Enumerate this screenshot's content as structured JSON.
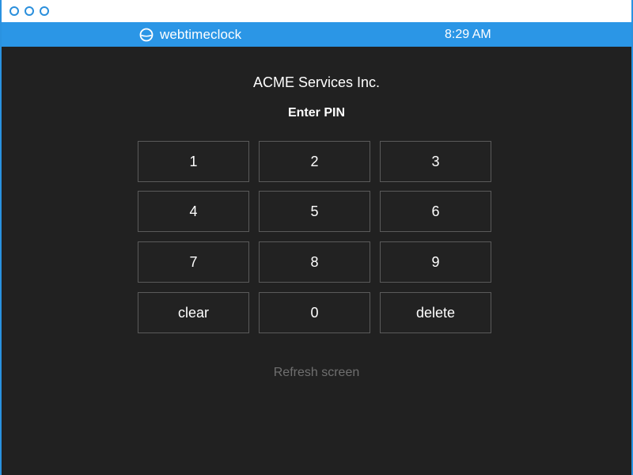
{
  "header": {
    "brand_name": "webtimeclock",
    "time": "8:29 AM"
  },
  "main": {
    "company": "ACME Services Inc.",
    "prompt": "Enter PIN"
  },
  "keypad": {
    "keys": [
      "1",
      "2",
      "3",
      "4",
      "5",
      "6",
      "7",
      "8",
      "9",
      "clear",
      "0",
      "delete"
    ]
  },
  "footer": {
    "refresh_label": "Refresh screen"
  },
  "colors": {
    "accent": "#2b96e6",
    "background": "#212121",
    "key_border": "#5a5a5a",
    "muted_text": "#6f6f6f"
  },
  "icons": {
    "brand": "clock-logo-icon",
    "window_controls": [
      "window-dot-icon",
      "window-dot-icon",
      "window-dot-icon"
    ]
  }
}
